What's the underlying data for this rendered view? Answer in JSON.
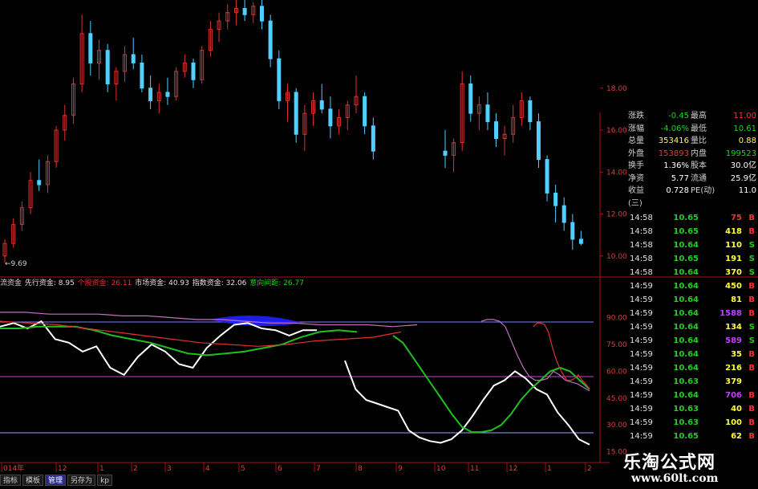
{
  "colors": {
    "up": "#e03030",
    "down": "#50d0ff",
    "bg": "#000000",
    "grid": "#7a0000",
    "white_line": "#ffffff",
    "green_line": "#20c020",
    "pink_line": "#c070c0",
    "buy": "#ff3030",
    "sell": "#20d020",
    "blue_fill": "#2020ff"
  },
  "price_axis": {
    "ticks": [
      "18.00",
      "16.00",
      "14.00",
      "12.00",
      "10.00"
    ],
    "low_label": "9.69",
    "ylim": [
      9.0,
      22.2
    ]
  },
  "indicator_axis": {
    "ticks": [
      "90.00",
      "75.00",
      "60.00",
      "45.00",
      "30.00",
      "15.00"
    ],
    "ylim": [
      9,
      106
    ]
  },
  "indicator_legend": [
    {
      "text": "流资金",
      "color": "#d0d0d0"
    },
    {
      "text": "先行资金: 8.95",
      "color": "#e0e0e0"
    },
    {
      "text": "个股资金: 26.11",
      "color": "#e03030"
    },
    {
      "text": "市场资金: 40.93",
      "color": "#e0e0e0"
    },
    {
      "text": "指数资金: 32.06",
      "color": "#e0e0e0"
    },
    {
      "text": "意向间距: 26.77",
      "color": "#20d020"
    }
  ],
  "date_axis": {
    "labels": [
      "014年",
      "12",
      "1",
      "2",
      "3",
      "4",
      "5",
      "6",
      "7",
      "8",
      "9",
      "10",
      "11",
      "12",
      "1",
      "2"
    ]
  },
  "chart_data": {
    "type": "candlestick",
    "price_ohlc": [
      [
        10.0,
        10.8,
        9.69,
        10.6
      ],
      [
        10.6,
        11.8,
        10.4,
        11.5
      ],
      [
        11.5,
        12.6,
        11.2,
        12.3
      ],
      [
        12.3,
        14.0,
        12.0,
        13.6
      ],
      [
        13.6,
        14.6,
        13.1,
        13.4
      ],
      [
        13.4,
        14.8,
        13.0,
        14.5
      ],
      [
        14.5,
        16.2,
        14.2,
        16.0
      ],
      [
        16.0,
        17.2,
        15.5,
        16.7
      ],
      [
        16.7,
        18.5,
        16.3,
        18.2
      ],
      [
        18.2,
        21.5,
        17.8,
        20.6
      ],
      [
        20.6,
        21.2,
        18.6,
        19.2
      ],
      [
        19.2,
        20.3,
        18.4,
        19.8
      ],
      [
        19.8,
        20.1,
        17.8,
        18.2
      ],
      [
        18.2,
        19.0,
        17.4,
        18.8
      ],
      [
        18.8,
        20.0,
        18.3,
        19.6
      ],
      [
        19.6,
        20.4,
        18.9,
        19.2
      ],
      [
        19.2,
        19.6,
        17.8,
        18.0
      ],
      [
        18.0,
        18.6,
        17.0,
        17.4
      ],
      [
        17.4,
        18.2,
        16.8,
        17.8
      ],
      [
        17.8,
        18.5,
        17.2,
        17.6
      ],
      [
        17.6,
        19.0,
        17.4,
        18.8
      ],
      [
        18.8,
        19.6,
        18.5,
        19.2
      ],
      [
        19.2,
        19.4,
        18.0,
        18.4
      ],
      [
        18.4,
        20.0,
        18.2,
        19.8
      ],
      [
        19.8,
        21.2,
        19.5,
        20.8
      ],
      [
        20.8,
        21.6,
        20.2,
        21.2
      ],
      [
        21.2,
        22.0,
        20.8,
        21.6
      ],
      [
        21.6,
        22.2,
        21.0,
        21.8
      ],
      [
        21.8,
        22.2,
        21.2,
        21.5
      ],
      [
        21.5,
        22.1,
        21.1,
        21.9
      ],
      [
        21.9,
        22.2,
        20.8,
        21.2
      ],
      [
        21.2,
        21.5,
        19.0,
        19.4
      ],
      [
        19.4,
        19.8,
        17.0,
        17.4
      ],
      [
        17.4,
        18.2,
        16.4,
        17.8
      ],
      [
        17.8,
        18.0,
        15.4,
        15.8
      ],
      [
        15.8,
        17.2,
        15.0,
        16.8
      ],
      [
        16.8,
        17.8,
        16.2,
        17.4
      ],
      [
        17.4,
        18.2,
        16.8,
        17.0
      ],
      [
        17.0,
        17.6,
        15.6,
        16.2
      ],
      [
        16.2,
        17.0,
        15.8,
        16.6
      ],
      [
        16.6,
        17.4,
        16.0,
        17.2
      ],
      [
        17.2,
        18.6,
        16.8,
        17.6
      ],
      [
        17.6,
        17.8,
        15.8,
        16.2
      ],
      [
        16.2,
        16.6,
        14.6,
        15.0
      ],
      [
        15.0,
        16.0,
        14.2,
        14.8
      ],
      [
        14.8,
        15.6,
        14.0,
        15.4
      ],
      [
        15.4,
        18.8,
        15.0,
        18.2
      ],
      [
        18.2,
        18.6,
        16.4,
        16.8
      ],
      [
        16.8,
        17.6,
        16.0,
        17.2
      ],
      [
        17.2,
        17.8,
        16.0,
        16.4
      ],
      [
        16.4,
        16.8,
        15.2,
        15.6
      ],
      [
        15.6,
        16.2,
        14.8,
        15.8
      ],
      [
        15.8,
        17.2,
        15.4,
        16.6
      ],
      [
        16.6,
        17.8,
        16.2,
        17.4
      ],
      [
        17.4,
        17.6,
        16.0,
        16.4
      ],
      [
        16.4,
        16.8,
        14.2,
        14.6
      ],
      [
        14.6,
        14.8,
        12.6,
        13.0
      ],
      [
        13.0,
        13.4,
        11.6,
        12.4
      ],
      [
        12.4,
        12.8,
        11.2,
        11.6
      ],
      [
        11.6,
        12.0,
        10.3,
        10.8
      ],
      [
        10.8,
        11.2,
        10.5,
        10.6
      ]
    ],
    "indicator_series": [
      {
        "name": "先行资金",
        "color": "#ffffff",
        "values": [
          85,
          87,
          84,
          88,
          78,
          76,
          71,
          74,
          62,
          58,
          68,
          75,
          71,
          64,
          62,
          73,
          80,
          86,
          87,
          84,
          83,
          80,
          83,
          83,
          66,
          50,
          44,
          42,
          40,
          38,
          27,
          23,
          21,
          20,
          22,
          27,
          35,
          44,
          52,
          55,
          60,
          56,
          50,
          47,
          37,
          30,
          22,
          19
        ]
      },
      {
        "name": "个股资金",
        "color": "#20c020",
        "values": [
          84,
          84,
          85,
          85,
          85,
          83,
          80,
          78,
          76,
          73,
          70,
          69,
          70,
          71,
          73,
          75,
          79,
          82,
          83,
          82,
          80,
          76,
          68,
          60,
          52,
          44,
          36,
          29,
          26,
          26,
          27,
          30,
          36,
          44,
          50,
          55,
          60,
          62,
          60,
          55,
          50
        ]
      },
      {
        "name": "市场资金",
        "color": "#c070c0",
        "values": [
          93,
          93,
          92,
          92,
          92,
          91,
          91,
          90,
          89,
          89,
          88,
          87,
          87,
          86,
          86,
          86,
          85,
          86,
          88,
          89,
          89,
          88,
          85,
          77,
          69,
          62,
          57,
          55,
          55,
          56,
          60,
          58,
          55,
          54,
          53,
          51,
          49
        ]
      },
      {
        "name": "指数资金",
        "color": "#e03030",
        "values": [
          88,
          87,
          86,
          84,
          82,
          80,
          78,
          76,
          75,
          74,
          75,
          77,
          78,
          79,
          82,
          85,
          87,
          87,
          86,
          82,
          74,
          67,
          62,
          58,
          55,
          55,
          56,
          58,
          55,
          53,
          50
        ]
      }
    ]
  },
  "quote_panel": {
    "rows": [
      {
        "l1": "涨跌",
        "v1": "-0.45",
        "c1": "#20d020",
        "l2": "最高",
        "v2": "11.00",
        "c2": "#ff3030"
      },
      {
        "l1": "涨幅",
        "v1": "-4.06%",
        "c1": "#20d020",
        "l2": "最低",
        "v2": "10.61",
        "c2": "#20d020"
      },
      {
        "l1": "总量",
        "v1": "353416",
        "c1": "#ffff40",
        "l2": "量比",
        "v2": "0.88",
        "c2": "#ffff40"
      },
      {
        "l1": "外盘",
        "v1": "153893",
        "c1": "#ff3030",
        "l2": "内盘",
        "v2": "199523",
        "c2": "#20d020"
      },
      {
        "l1": "换手",
        "v1": "1.36%",
        "c1": "#ffffff",
        "l2": "股本",
        "v2": "30.0亿",
        "c2": "#ffffff"
      },
      {
        "l1": "净资",
        "v1": "5.77",
        "c1": "#ffffff",
        "l2": "流通",
        "v2": "25.9亿",
        "c2": "#ffffff"
      },
      {
        "l1": "收益(三)",
        "v1": "0.728",
        "c1": "#ffffff",
        "l2": "PE(动)",
        "v2": "11.0",
        "c2": "#ffffff"
      }
    ]
  },
  "ticks": [
    {
      "time": "14:58",
      "price": "10.65",
      "vol": "75",
      "side": "B",
      "vc": "#ff3030"
    },
    {
      "time": "14:58",
      "price": "10.65",
      "vol": "418",
      "side": "B",
      "vc": "#ffff40"
    },
    {
      "time": "14:58",
      "price": "10.64",
      "vol": "110",
      "side": "S",
      "vc": "#ffff40"
    },
    {
      "time": "14:58",
      "price": "10.65",
      "vol": "191",
      "side": "S",
      "vc": "#ffff40"
    },
    {
      "time": "14:58",
      "price": "10.64",
      "vol": "370",
      "side": "S",
      "vc": "#ffff40"
    },
    {
      "time": "14:59",
      "price": "10.64",
      "vol": "450",
      "side": "B",
      "vc": "#ffff40"
    },
    {
      "time": "14:59",
      "price": "10.64",
      "vol": "81",
      "side": "B",
      "vc": "#ffff40"
    },
    {
      "time": "14:59",
      "price": "10.64",
      "vol": "1588",
      "side": "B",
      "vc": "#c040ff"
    },
    {
      "time": "14:59",
      "price": "10.64",
      "vol": "134",
      "side": "S",
      "vc": "#ffff40"
    },
    {
      "time": "14:59",
      "price": "10.64",
      "vol": "589",
      "side": "S",
      "vc": "#c040ff"
    },
    {
      "time": "14:59",
      "price": "10.64",
      "vol": "35",
      "side": "B",
      "vc": "#ffff40"
    },
    {
      "time": "14:59",
      "price": "10.64",
      "vol": "216",
      "side": "B",
      "vc": "#ffff40"
    },
    {
      "time": "14:59",
      "price": "10.63",
      "vol": "379",
      "side": "",
      "vc": "#ffff40"
    },
    {
      "time": "14:59",
      "price": "10.64",
      "vol": "706",
      "side": "B",
      "vc": "#c040ff"
    },
    {
      "time": "14:59",
      "price": "10.63",
      "vol": "40",
      "side": "B",
      "vc": "#ffff40"
    },
    {
      "time": "14:59",
      "price": "10.63",
      "vol": "100",
      "side": "B",
      "vc": "#ffff40"
    },
    {
      "time": "14:59",
      "price": "10.65",
      "vol": "62",
      "side": "B",
      "vc": "#ffff40"
    }
  ],
  "toolbar": {
    "items": [
      {
        "label": "指标",
        "active": false
      },
      {
        "label": "模板",
        "active": false
      },
      {
        "label": "管理",
        "active": true
      },
      {
        "label": "另存为",
        "active": false
      },
      {
        "label": "kp",
        "active": false
      }
    ]
  },
  "watermark": {
    "title": "乐淘公式网",
    "url": "www.60lt.com"
  }
}
